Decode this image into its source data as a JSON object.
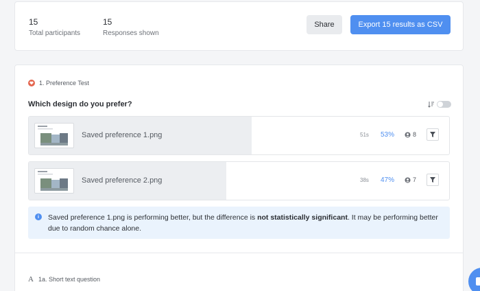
{
  "summary": {
    "total_participants_value": "15",
    "total_participants_label": "Total participants",
    "responses_shown_value": "15",
    "responses_shown_label": "Responses shown",
    "share_label": "Share",
    "export_label": "Export 15 results as CSV"
  },
  "question": {
    "type_label": "1. Preference Test",
    "type_icon": "heart-icon",
    "text": "Which design do you prefer?",
    "options": [
      {
        "name": "Saved preference 1.png",
        "time": "51s",
        "percent": "53%",
        "fill_fraction": 0.53,
        "count": "8"
      },
      {
        "name": "Saved preference 2.png",
        "time": "38s",
        "percent": "47%",
        "fill_fraction": 0.47,
        "count": "7"
      }
    ],
    "info": {
      "text_before": "Saved preference 1.png is performing better, but the difference is ",
      "text_bold": "not statistically significant",
      "text_after": ". It may be performing better due to random chance alone."
    }
  },
  "sub_question": {
    "icon": "text-A-icon",
    "icon_glyph": "A",
    "label": "1a. Short text question"
  },
  "colors": {
    "accent": "#4f8ff0",
    "preference_icon": "#e4664f",
    "info_bg": "#eaf3fd"
  }
}
